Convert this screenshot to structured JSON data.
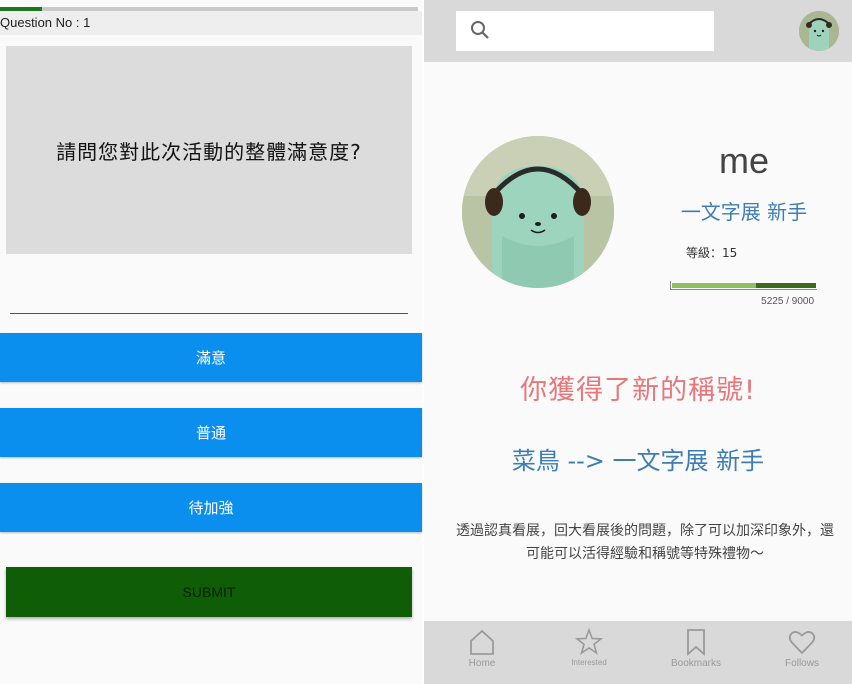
{
  "quiz": {
    "progress_fraction": 0.1,
    "question_no": "Question No : 1",
    "question": "請問您對此次活動的整體滿意度?",
    "answer_value": "",
    "options": [
      "滿意",
      "普通",
      "待加強"
    ],
    "submit_label": "SUBMIT",
    "colors": {
      "option_button": "#0a8fef",
      "submit_button": "#0f5e07",
      "progress": "#1b7a1b"
    }
  },
  "profile": {
    "search": {
      "placeholder": "",
      "icon": "search-icon"
    },
    "username": "me",
    "user_title": "一文字展 新手",
    "level_label": "等級：15",
    "xp": {
      "current": 5225,
      "max": 9000,
      "text": "5225 / 9000"
    },
    "new_title_heading": "你獲得了新的稱號!",
    "title_change": "菜鳥 --> 一文字展 新手",
    "description": "透過認真看展，回大看展後的問題，除了可以加深印象外，還可能可以活得經驗和稱號等特殊禮物～",
    "nav": [
      {
        "label": "Home",
        "icon": "home-icon"
      },
      {
        "label": "Interested",
        "icon": "star-icon"
      },
      {
        "label": "Bookmarks",
        "icon": "bookmark-icon"
      },
      {
        "label": "Follows",
        "icon": "heart-icon"
      }
    ],
    "colors": {
      "title_blue": "#3e7db4",
      "heading_pink": "#e6777a",
      "xp_fill": "#8fc060"
    }
  }
}
